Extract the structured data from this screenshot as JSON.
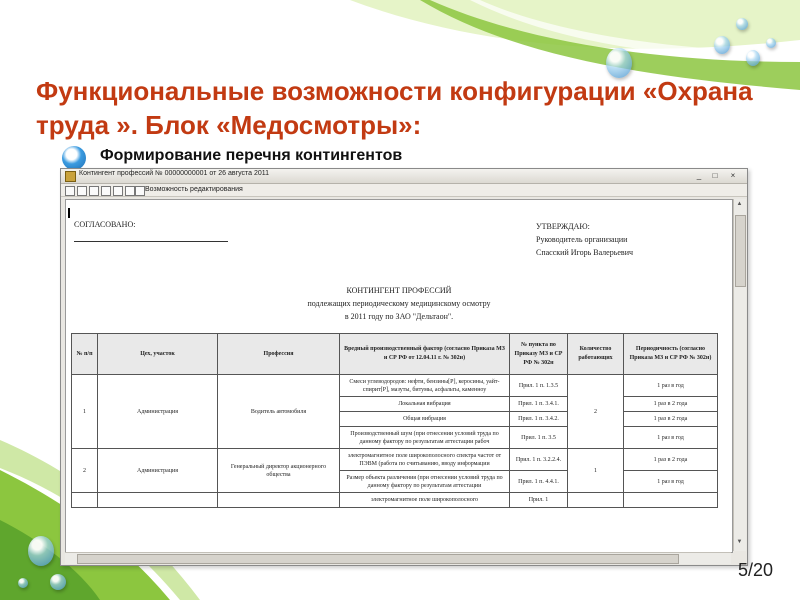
{
  "slide": {
    "title": "Функциональные возможности конфигурации «Охрана труда ». Блок «Медосмотры»:",
    "bullet": "Формирование перечня контингентов",
    "page_number": "5/20"
  },
  "window": {
    "title": "Контингент профессий № 00000000001 от 26 августа 2011",
    "edit_toggle_label": "Возможность редактирования",
    "minimize": "_",
    "maximize": "□",
    "close": "×"
  },
  "document": {
    "agreed": "СОГЛАСОВАНО:",
    "approve_heading": "УТВЕРЖДАЮ:",
    "approve_role": "Руководитель организации",
    "approve_name": "Спасский Игорь Валерьевич",
    "doc_title": "КОНТИНГЕНТ ПРОФЕССИЙ",
    "doc_subtitle": "подлежащих периодическому медицинскому осмотру",
    "doc_year": "в 2011 году по ЗАО \"Дельтаон\"."
  },
  "table": {
    "headers": [
      "№ п/п",
      "Цех, участок",
      "Профессия",
      "Вредный производственный фактор (согласно Приказа МЗ и СР РФ от 12.04.11 г. № 302н)",
      "№ пункта по Приказу МЗ и СР РФ № 302н",
      "Количество работающих",
      "Периодичность (согласно Приказа МЗ и СР РФ № 302н)"
    ],
    "rows": [
      {
        "num": "1",
        "dept": "Администрация",
        "prof": "Водитель автомобиля",
        "count": "2",
        "factors": [
          {
            "factor": "Смеси углеводородов: нефти, бензины[Р], керосины, уайт-спирит[Р], мазуты, битумы, асфальты, каменноу",
            "clause": "Прил. 1 п. 1.3.5",
            "period": "1 раз в год"
          },
          {
            "factor": "Локальная вибрация",
            "clause": "Прил. 1 п. 3.4.1.",
            "period": "1 раз в 2 года"
          },
          {
            "factor": "Общая вибрация",
            "clause": "Прил. 1 п. 3.4.2.",
            "period": "1 раз в 2 года"
          },
          {
            "factor": "Производственный шум (при отнесении условий труда по данному фактору по результатам аттестации рабоч",
            "clause": "Прил. 1 п. 3.5",
            "period": "1 раз в год"
          }
        ]
      },
      {
        "num": "2",
        "dept": "Администрация",
        "prof": "Генеральный директор акционерного общества",
        "count": "1",
        "factors": [
          {
            "factor": "электромагнитное поле широкополосного спектра частот от ПЭВМ (работа по считыванию, вводу информации",
            "clause": "Прил. 1 п. 3.2.2.4.",
            "period": "1 раз в 2 года"
          },
          {
            "factor": "Размер объекта различения (при отнесении условий труда по данному фактору по результатам аттестации",
            "clause": "Прил. 1 п. 4.4.1.",
            "period": "1 раз в год"
          }
        ]
      },
      {
        "num": "",
        "dept": "",
        "prof": "",
        "count": "",
        "factors": [
          {
            "factor": "электромагнитное поле широкополосного",
            "clause": "Прил. 1",
            "period": ""
          }
        ]
      }
    ]
  },
  "colors": {
    "title": "#c23a12",
    "accent_green": "#8cc63f",
    "bullet_blue": "#1f6fb5"
  },
  "icons": [
    "app-icon",
    "bullet-orb-icon",
    "water-drop-icon"
  ]
}
